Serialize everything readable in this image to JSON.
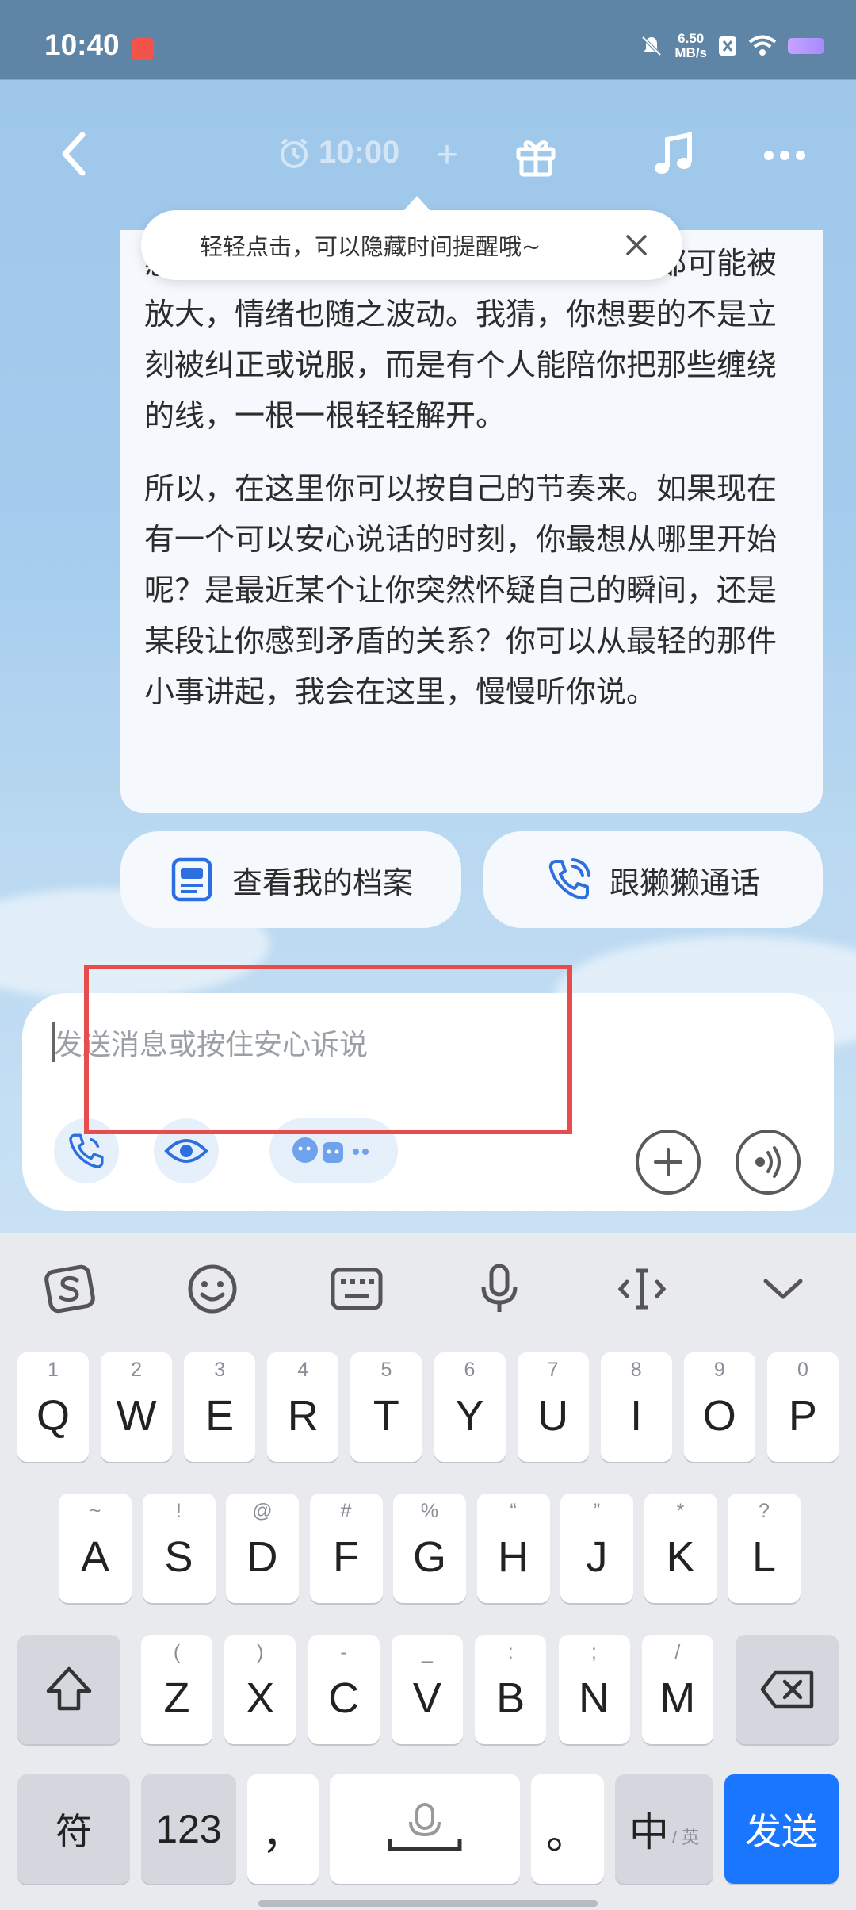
{
  "status_bar": {
    "time": "10:40",
    "net_speed_value": "6.50",
    "net_speed_unit": "MB/s",
    "icons": [
      "app-notification-icon",
      "mute-icon",
      "data-icon",
      "wifi-icon",
      "battery-icon"
    ]
  },
  "nav": {
    "timer_text": "10:00",
    "timer_plus": "+",
    "icons": [
      "back-icon",
      "alarm-icon",
      "gift-icon",
      "music-icon",
      "more-icon"
    ]
  },
  "tooltip": {
    "text": "轻轻点击，可以隐藏时间提醒哦~"
  },
  "message": {
    "para1": "感受不够确定时，外界的一点风吹草动都可能被放大，情绪也随之波动。我猜，你想要的不是立刻被纠正或说服，而是有个人能陪你把那些缠绕的线，一根一根轻轻解开。",
    "para2": "所以，在这里你可以按自己的节奏来。如果现在有一个可以安心说话的时刻，你最想从哪里开始呢？是最近某个让你突然怀疑自己的瞬间，还是某段让你感到矛盾的关系？你可以从最轻的那件小事讲起，我会在这里，慢慢听你说。"
  },
  "quick_actions": {
    "profile_label": "查看我的档案",
    "call_label": "跟獭獭通话"
  },
  "composer": {
    "placeholder": "发送消息或按住安心诉说",
    "value": ""
  },
  "keyboard": {
    "toolbar_icons": [
      "sogou-logo-icon",
      "emoji-icon",
      "keyboard-icon",
      "microphone-icon",
      "cursor-move-icon",
      "collapse-icon"
    ],
    "row1": [
      {
        "hint": "1",
        "key": "Q"
      },
      {
        "hint": "2",
        "key": "W"
      },
      {
        "hint": "3",
        "key": "E"
      },
      {
        "hint": "4",
        "key": "R"
      },
      {
        "hint": "5",
        "key": "T"
      },
      {
        "hint": "6",
        "key": "Y"
      },
      {
        "hint": "7",
        "key": "U"
      },
      {
        "hint": "8",
        "key": "I"
      },
      {
        "hint": "9",
        "key": "O"
      },
      {
        "hint": "0",
        "key": "P"
      }
    ],
    "row2": [
      {
        "hint": "~",
        "key": "A"
      },
      {
        "hint": "!",
        "key": "S"
      },
      {
        "hint": "@",
        "key": "D"
      },
      {
        "hint": "#",
        "key": "F"
      },
      {
        "hint": "%",
        "key": "G"
      },
      {
        "hint": "“",
        "key": "H"
      },
      {
        "hint": "”",
        "key": "J"
      },
      {
        "hint": "*",
        "key": "K"
      },
      {
        "hint": "?",
        "key": "L"
      }
    ],
    "row3": [
      {
        "hint": "(",
        "key": "Z"
      },
      {
        "hint": ")",
        "key": "X"
      },
      {
        "hint": "-",
        "key": "C"
      },
      {
        "hint": "_",
        "key": "V"
      },
      {
        "hint": ":",
        "key": "B"
      },
      {
        "hint": ";",
        "key": "N"
      },
      {
        "hint": "/",
        "key": "M"
      }
    ],
    "symbols_label": "符",
    "numbers_label": "123",
    "comma_label": "，",
    "period_label": "。",
    "lang_label": "中",
    "lang_sub_label": "/ 英",
    "send_label": "发送"
  }
}
